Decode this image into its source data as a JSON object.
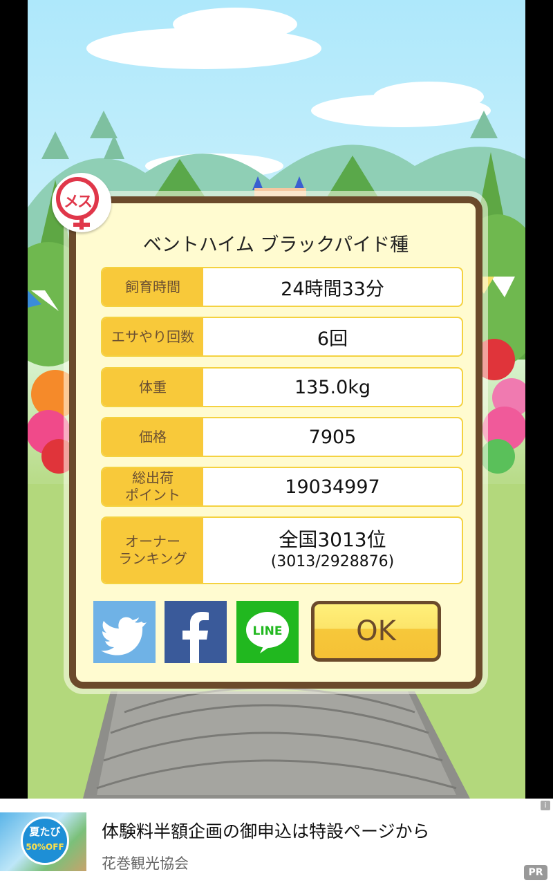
{
  "gender_badge": {
    "label": "メス",
    "icon": "female-symbol-icon"
  },
  "card": {
    "title": "ベントハイム ブラックパイド種",
    "rows": [
      {
        "label": "飼育時間",
        "value": "24時間33分"
      },
      {
        "label": "エサやり回数",
        "value": "6回"
      },
      {
        "label": "体重",
        "value": "135.0kg"
      },
      {
        "label": "価格",
        "value": "7905"
      },
      {
        "label": "総出荷\nポイント",
        "value": "19034997"
      },
      {
        "label": "オーナー\nランキング",
        "value": "全国3013位",
        "value_sub": "(3013/2928876)"
      }
    ]
  },
  "share": {
    "twitter_icon": "twitter-bird-icon",
    "facebook_icon": "facebook-f-icon",
    "line_label": "LINE"
  },
  "ok_label": "OK",
  "ad": {
    "title": "体験料半額企画の御申込は特設ページから",
    "sponsor": "花巻観光協会",
    "info_label": "i",
    "pr_label": "PR",
    "thumb": {
      "badge_text": "夏たび",
      "discount": "50%OFF"
    }
  },
  "colors": {
    "card_border": "#6b4a2b",
    "card_bg": "#fffbd0",
    "label_bg": "#f8c93a",
    "ok_button": "#f6c83b",
    "female_red": "#e0374a"
  }
}
